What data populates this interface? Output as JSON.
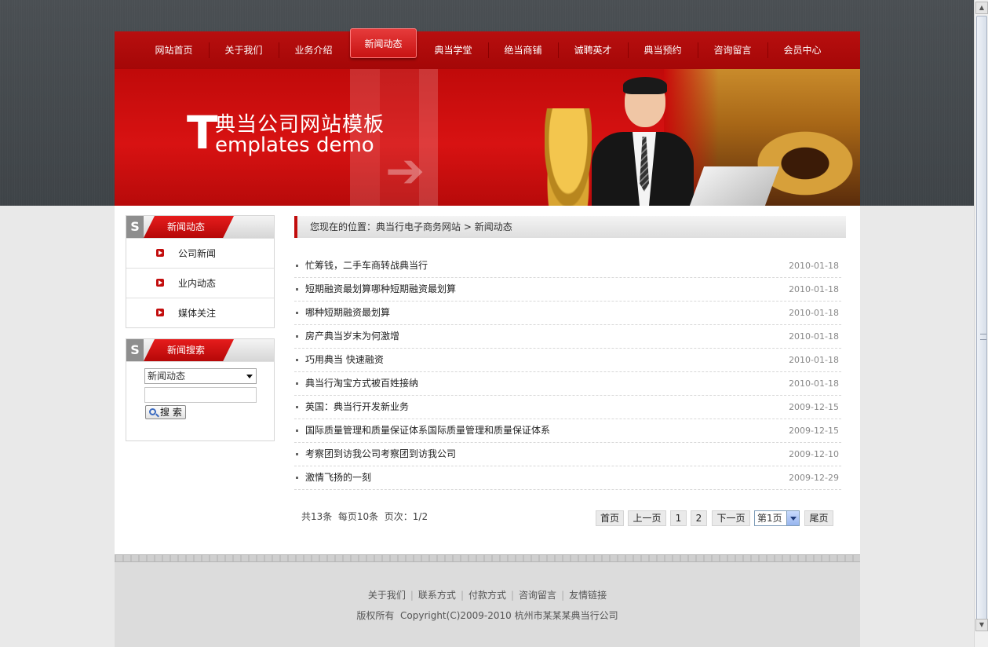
{
  "nav": {
    "items": [
      "网站首页",
      "关于我们",
      "业务介绍",
      "新闻动态",
      "典当学堂",
      "绝当商铺",
      "诚聘英才",
      "典当预约",
      "咨询留言",
      "会员中心"
    ],
    "active_index": 3
  },
  "banner": {
    "big_letter": "T",
    "title_cn": "典当公司网站模板",
    "title_en": "emplates demo"
  },
  "sidebar": {
    "categories": {
      "badge": "S",
      "title": "新闻动态",
      "items": [
        "公司新闻",
        "业内动态",
        "媒体关注"
      ]
    },
    "search": {
      "badge": "S",
      "title": "新闻搜索",
      "select_value": "新闻动态",
      "input_value": "",
      "button_label": "搜 索"
    }
  },
  "breadcrumb": {
    "prefix": "您现在的位置：",
    "site": "典当行电子商务网站",
    "sep": " > ",
    "current": "新闻动态"
  },
  "news": [
    {
      "title": "忙筹钱，二手车商转战典当行",
      "date": "2010-01-18"
    },
    {
      "title": "短期融资最划算哪种短期融资最划算",
      "date": "2010-01-18"
    },
    {
      "title": "哪种短期融资最划算",
      "date": "2010-01-18"
    },
    {
      "title": "房产典当岁末为何激增",
      "date": "2010-01-18"
    },
    {
      "title": "巧用典当 快速融资",
      "date": "2010-01-18"
    },
    {
      "title": "典当行淘宝方式被百姓接纳",
      "date": "2010-01-18"
    },
    {
      "title": "英国：典当行开发新业务",
      "date": "2009-12-15"
    },
    {
      "title": "国际质量管理和质量保证体系国际质量管理和质量保证体系",
      "date": "2009-12-15"
    },
    {
      "title": "考察团到访我公司考察团到访我公司",
      "date": "2009-12-10"
    },
    {
      "title": "激情飞扬的一刻",
      "date": "2009-12-29"
    }
  ],
  "pager": {
    "info": "共13条  每页10条  页次：1/2",
    "first": "首页",
    "prev": "上一页",
    "pages": [
      "1",
      "2"
    ],
    "next": "下一页",
    "select_value": "第1页",
    "last": "尾页"
  },
  "footer": {
    "links": [
      "关于我们",
      "联系方式",
      "付款方式",
      "咨询留言",
      "友情链接"
    ],
    "copyright": "版权所有  Copyright(C)2009-2010 杭州市某某某典当行公司"
  },
  "colors": {
    "brand_red": "#c10c0c",
    "top_band": "#44494d",
    "footer_bg": "#dcdcdc"
  }
}
